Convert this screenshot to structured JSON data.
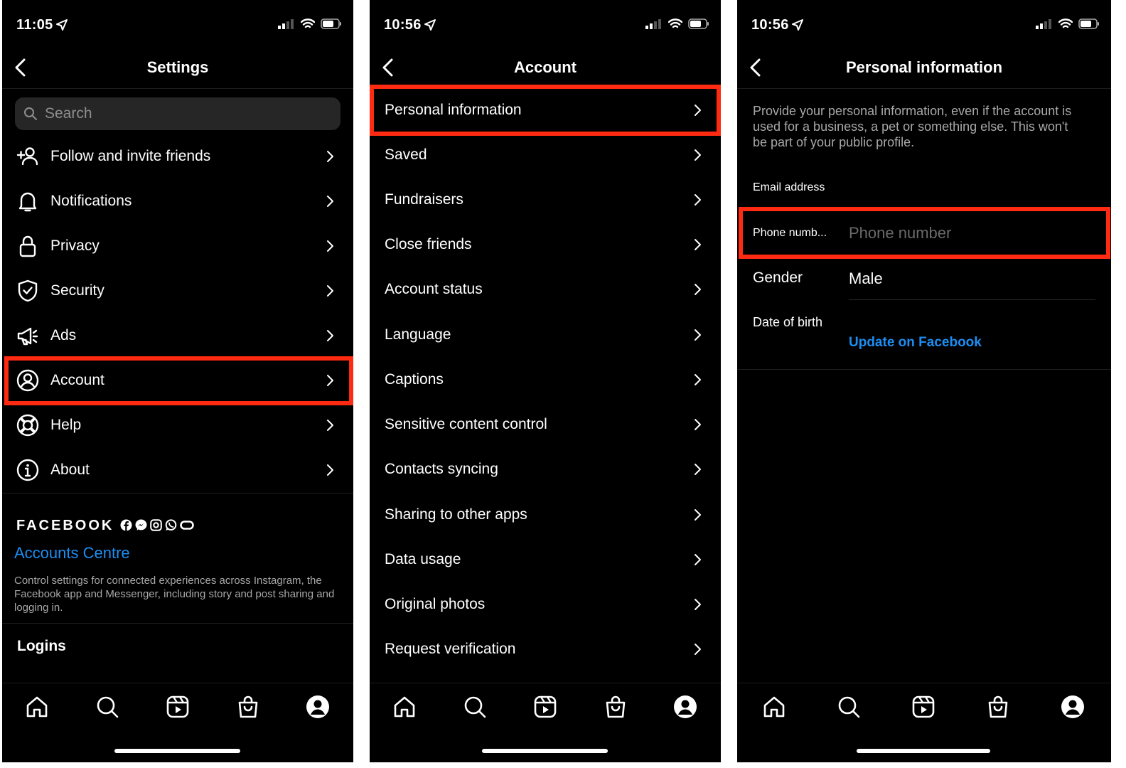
{
  "colors": {
    "highlight": "#ff2a12",
    "link": "#1c8ef2",
    "background": "#000000"
  },
  "screen1": {
    "time": "11:05",
    "title": "Settings",
    "search_placeholder": "Search",
    "items": [
      {
        "label": "Follow and invite friends",
        "icon": "add-person-icon"
      },
      {
        "label": "Notifications",
        "icon": "bell-icon"
      },
      {
        "label": "Privacy",
        "icon": "lock-icon"
      },
      {
        "label": "Security",
        "icon": "shield-icon"
      },
      {
        "label": "Ads",
        "icon": "megaphone-icon"
      },
      {
        "label": "Account",
        "icon": "account-circle-icon"
      },
      {
        "label": "Help",
        "icon": "lifebuoy-icon"
      },
      {
        "label": "About",
        "icon": "info-icon"
      }
    ],
    "facebook_brand": "FACEBOOK",
    "accounts_centre": "Accounts Centre",
    "accounts_centre_desc": "Control settings for connected experiences across Instagram, the Facebook app and Messenger, including story and post sharing and logging in.",
    "logins": "Logins"
  },
  "screen2": {
    "time": "10:56",
    "title": "Account",
    "items": [
      "Personal information",
      "Saved",
      "Fundraisers",
      "Close friends",
      "Account status",
      "Language",
      "Captions",
      "Sensitive content control",
      "Contacts syncing",
      "Sharing to other apps",
      "Data usage",
      "Original photos",
      "Request verification"
    ]
  },
  "screen3": {
    "time": "10:56",
    "title": "Personal information",
    "description": "Provide your personal information, even if the account is used for a business, a pet or something else. This won't be part of your public profile.",
    "email_label": "Email address",
    "phone_label": "Phone numb...",
    "phone_placeholder": "Phone number",
    "gender_label": "Gender",
    "gender_value": "Male",
    "dob_label": "Date of birth",
    "update_link": "Update on Facebook"
  },
  "tabbar": [
    "home-icon",
    "search-icon",
    "reels-icon",
    "shop-icon",
    "profile-icon"
  ]
}
